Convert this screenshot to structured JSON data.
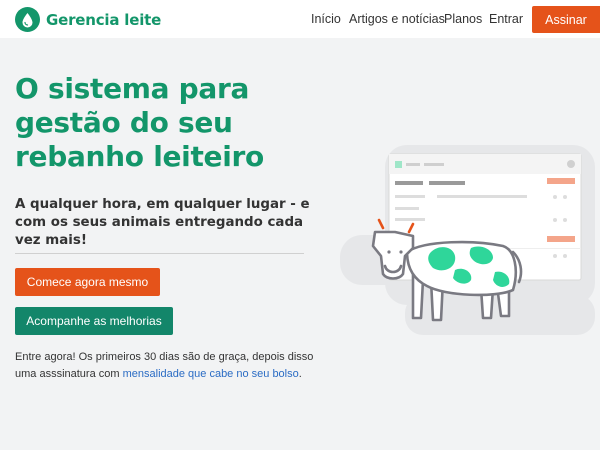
{
  "nav": {
    "brand": "Gerencia leite",
    "links": [
      "Início",
      "Artigos e notícias",
      "Planos",
      "Entrar"
    ],
    "cta": "Assinar"
  },
  "hero": {
    "headline": "O sistema para gestão do seu rebanho leiteiro",
    "subheadline": "A qualquer hora, em qualquer lugar - e com os seus animais entregando cada vez mais!",
    "primary_button": "Comece agora mesmo",
    "secondary_button": "Acompanhe as melhorias",
    "footnote_text": "Entre agora! Os primeiros 30 dias são de graça, depois disso uma asssinatura com ",
    "footnote_link": "mensalidade que cabe no seu bolso",
    "footnote_end": "."
  },
  "colors": {
    "brand_green": "#13966a",
    "button_green": "#13866a",
    "accent_orange": "#e5531a",
    "link_blue": "#2b6cc4",
    "cow_spots": "#2fd69a",
    "background": "#f2f3f4"
  },
  "icons": {
    "logo": "milk-drop-icon",
    "illustration": "cow-dashboard-illustration"
  }
}
